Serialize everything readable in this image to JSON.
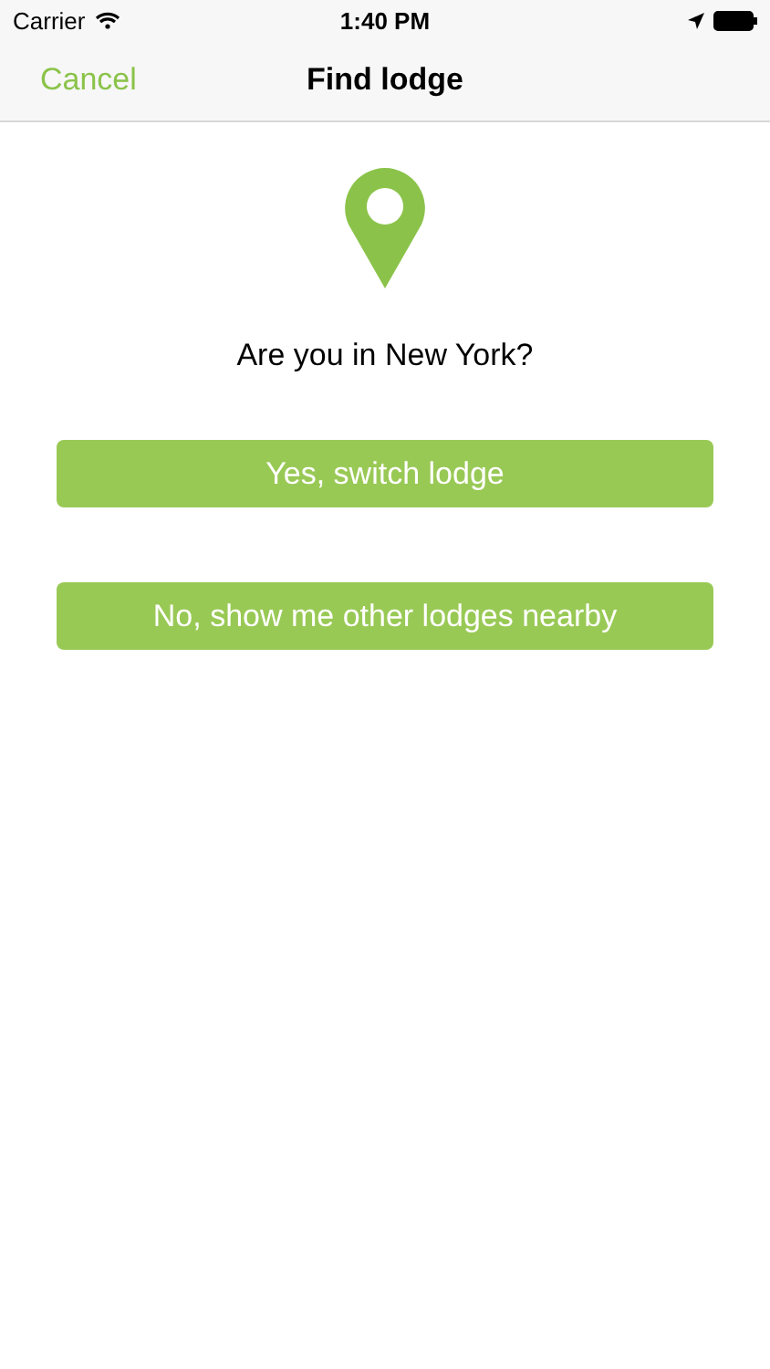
{
  "status_bar": {
    "carrier": "Carrier",
    "time": "1:40 PM"
  },
  "nav_bar": {
    "cancel": "Cancel",
    "title": "Find lodge"
  },
  "question": "Are you in New York?",
  "buttons": [
    "Yes, switch lodge",
    "No, show me other lodges nearby"
  ]
}
